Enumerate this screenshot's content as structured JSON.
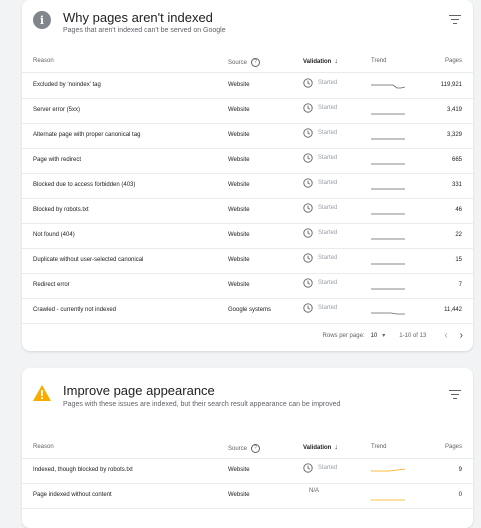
{
  "not_indexed": {
    "title": "Why pages aren't indexed",
    "subtitle": "Pages that aren't indexed can't be served on Google",
    "icon": "info-icon",
    "columns": {
      "reason": "Reason",
      "source": "Source",
      "validation": "Validation",
      "trend": "Trend",
      "pages": "Pages"
    },
    "rows": [
      {
        "reason": "Excluded by ‘noindex’ tag",
        "source": "Website",
        "validation": "Started",
        "pages": "119,921"
      },
      {
        "reason": "Server error (5xx)",
        "source": "Website",
        "validation": "Started",
        "pages": "3,419"
      },
      {
        "reason": "Alternate page with proper canonical tag",
        "source": "Website",
        "validation": "Started",
        "pages": "3,329"
      },
      {
        "reason": "Page with redirect",
        "source": "Website",
        "validation": "Started",
        "pages": "665"
      },
      {
        "reason": "Blocked due to access forbidden (403)",
        "source": "Website",
        "validation": "Started",
        "pages": "331"
      },
      {
        "reason": "Blocked by robots.txt",
        "source": "Website",
        "validation": "Started",
        "pages": "46"
      },
      {
        "reason": "Not found (404)",
        "source": "Website",
        "validation": "Started",
        "pages": "22"
      },
      {
        "reason": "Duplicate without user-selected canonical",
        "source": "Website",
        "validation": "Started",
        "pages": "15"
      },
      {
        "reason": "Redirect error",
        "source": "Website",
        "validation": "Started",
        "pages": "7"
      },
      {
        "reason": "Crawled - currently not indexed",
        "source": "Google systems",
        "validation": "Started",
        "pages": "11,442"
      }
    ],
    "pagination": {
      "rows_per_page_label": "Rows per page:",
      "rows_per_page": "10",
      "range": "1-10 of 13"
    }
  },
  "appearance": {
    "title": "Improve page appearance",
    "subtitle": "Pages with these issues are indexed, but their search result appearance can be improved",
    "icon": "warning-icon",
    "columns": {
      "reason": "Reason",
      "source": "Source",
      "validation": "Validation",
      "trend": "Trend",
      "pages": "Pages"
    },
    "rows": [
      {
        "reason": "Indexed, though blocked by robots.txt",
        "source": "Website",
        "validation": "Started",
        "pages": "9"
      },
      {
        "reason": "Page indexed without content",
        "source": "Website",
        "validation": "N/A",
        "pages": "0"
      }
    ]
  },
  "colors": {
    "trend_gray": "#5f6368",
    "trend_orange": "#f9ab00",
    "warning": "#f9ab00",
    "status_gray": "#9aa0a6"
  }
}
